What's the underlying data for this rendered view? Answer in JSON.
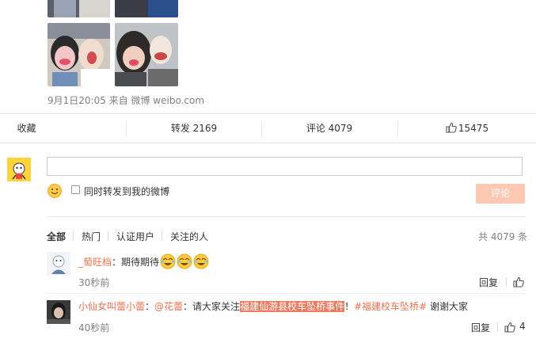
{
  "post": {
    "meta": "9月1日20:05 来自 微博 weibo.com"
  },
  "actions": {
    "collect": "收藏",
    "repost": "转发 2169",
    "comment": "评论 4079",
    "like": "15475"
  },
  "composer": {
    "input_value": "",
    "also_repost_label": "同时转发到我的微博",
    "submit_label": "评论"
  },
  "filters": {
    "items": [
      "全部",
      "热门",
      "认证用户",
      "关注的人"
    ],
    "total": "共 4079 条"
  },
  "comments": [
    {
      "name": "_萄旺档",
      "sep": "：",
      "text": "期待期待",
      "emoji": [
        "laugh-cry-emoji",
        "laugh-cry-emoji",
        "laugh-cry-emoji"
      ],
      "time": "30秒前",
      "reply": "回复",
      "likes": ""
    },
    {
      "name": "小仙女叫蕾小蕾",
      "sep": "：",
      "mention": "@花蕾",
      "text1": "：请大家关注",
      "highlight": "福建仙游县校车坠桥事件",
      "text2": "！",
      "topic": "#福建校车坠桥#",
      "text3": " 谢谢大家",
      "time": "40秒前",
      "reply": "回复",
      "likes": "4"
    }
  ],
  "colors": {
    "accent": "#eb7350",
    "highlight": "#e97b5e",
    "submit_disabled": "#fdc8b1",
    "muted": "#808080"
  }
}
